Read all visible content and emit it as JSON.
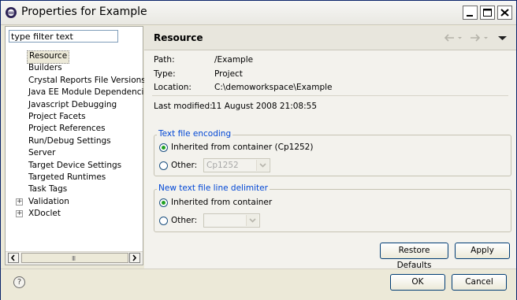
{
  "window": {
    "title": "Properties for Example"
  },
  "filter": {
    "placeholder": "type filter text"
  },
  "tree": {
    "items": [
      {
        "label": "Resource",
        "selected": true,
        "expandable": false
      },
      {
        "label": "Builders",
        "expandable": false
      },
      {
        "label": "Crystal Reports File Versions",
        "expandable": false
      },
      {
        "label": "Java EE Module Dependencies",
        "expandable": false
      },
      {
        "label": "Javascript Debugging",
        "expandable": false
      },
      {
        "label": "Project Facets",
        "expandable": false
      },
      {
        "label": "Project References",
        "expandable": false
      },
      {
        "label": "Run/Debug Settings",
        "expandable": false
      },
      {
        "label": "Server",
        "expandable": false
      },
      {
        "label": "Target Device Settings",
        "expandable": false
      },
      {
        "label": "Targeted Runtimes",
        "expandable": false
      },
      {
        "label": "Task Tags",
        "expandable": false
      },
      {
        "label": "Validation",
        "expandable": true
      },
      {
        "label": "XDoclet",
        "expandable": true
      }
    ],
    "scroll_grip": "III"
  },
  "page": {
    "title": "Resource",
    "path_label": "Path:",
    "path_value": "/Example",
    "type_label": "Type:",
    "type_value": "Project",
    "location_label": "Location:",
    "location_value": "C:\\demoworkspace\\Example",
    "modified_label": "Last modified:",
    "modified_value": "11 August 2008 21:08:55"
  },
  "encoding": {
    "group_title": "Text file encoding",
    "inherited_label": "Inherited from container (Cp1252)",
    "other_label": "Other:",
    "other_value": "Cp1252",
    "selected": "inherited"
  },
  "delimiter": {
    "group_title": "New text file line delimiter",
    "inherited_label": "Inherited from container",
    "other_label": "Other:",
    "other_value": "",
    "selected": "inherited"
  },
  "buttons": {
    "restore_defaults": "Restore Defaults",
    "apply": "Apply",
    "ok": "OK",
    "cancel": "Cancel",
    "help_glyph": "?"
  },
  "colors": {
    "group_title": "#0046d5",
    "radio_dot": "#21a121",
    "title_bar": "#e9e8e2",
    "dialog_bg": "#ece9d8"
  }
}
